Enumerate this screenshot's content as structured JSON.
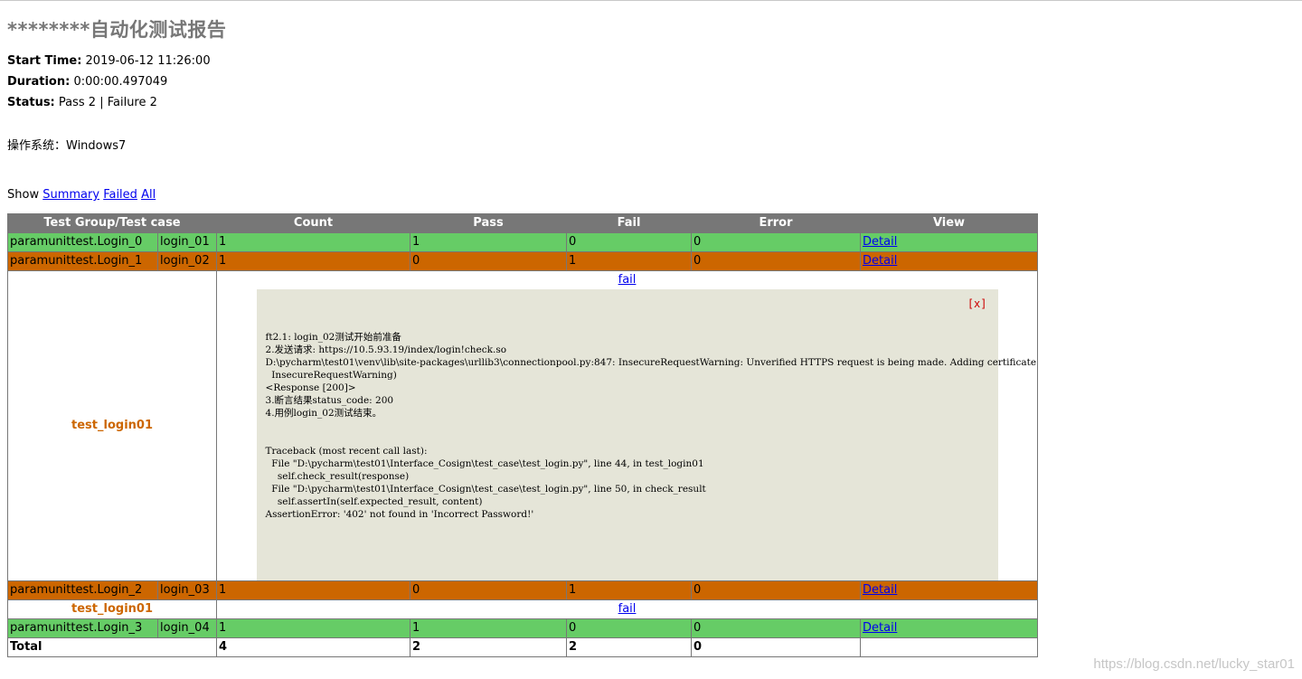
{
  "report": {
    "title": "********自动化测试报告",
    "start_time_label": "Start Time:",
    "start_time": "2019-06-12 11:26:00",
    "duration_label": "Duration:",
    "duration": "0:00:00.497049",
    "status_label": "Status:",
    "status": "Pass 2 | Failure 2",
    "os_line": "操作系统：Windows7"
  },
  "show": {
    "label": "Show",
    "summary": "Summary",
    "failed": "Failed",
    "all": "All"
  },
  "table": {
    "headers": [
      "Test Group/Test case",
      "Count",
      "Pass",
      "Fail",
      "Error",
      "View"
    ],
    "rows": [
      {
        "group": "paramunittest.Login_0",
        "case": "login_01",
        "count": "1",
        "pass": "1",
        "fail": "0",
        "error": "0",
        "view": "Detail"
      },
      {
        "group": "paramunittest.Login_1",
        "case": "login_02",
        "count": "1",
        "pass": "0",
        "fail": "1",
        "error": "0",
        "view": "Detail"
      },
      {
        "group": "paramunittest.Login_2",
        "case": "login_03",
        "count": "1",
        "pass": "0",
        "fail": "1",
        "error": "0",
        "view": "Detail"
      },
      {
        "group": "paramunittest.Login_3",
        "case": "login_04",
        "count": "1",
        "pass": "1",
        "fail": "0",
        "error": "0",
        "view": "Detail"
      }
    ],
    "detail1": {
      "test_name": "test_login01",
      "status_link": "fail",
      "close": "[x]",
      "log": "ft2.1: login_02测试开始前准备\n2.发送请求: https://10.5.93.19/index/login!check.so\nD:\\pycharm\\test01\\venv\\lib\\site-packages\\urllib3\\connectionpool.py:847: InsecureRequestWarning: Unverified HTTPS request is being made. Adding certificate verification is strongly advised. Se\n  InsecureRequestWarning)\n<Response [200]>\n3.断言结果status_code: 200\n4.用例login_02测试结束。\n\n\nTraceback (most recent call last):\n  File \"D:\\pycharm\\test01\\Interface_Cosign\\test_case\\test_login.py\", line 44, in test_login01\n    self.check_result(response)\n  File \"D:\\pycharm\\test01\\Interface_Cosign\\test_case\\test_login.py\", line 50, in check_result\n    self.assertIn(self.expected_result, content)\nAssertionError: '402' not found in 'Incorrect Password!'"
    },
    "detail2": {
      "test_name": "test_login01",
      "status_link": "fail"
    },
    "total": {
      "label": "Total",
      "count": "4",
      "pass": "2",
      "fail": "2",
      "error": "0"
    }
  },
  "watermark": "https://blog.csdn.net/lucky_star01",
  "colors": {
    "pass": "#66cc66",
    "fail": "#cc6600",
    "header": "#777777",
    "popup": "#e5e5d8"
  }
}
